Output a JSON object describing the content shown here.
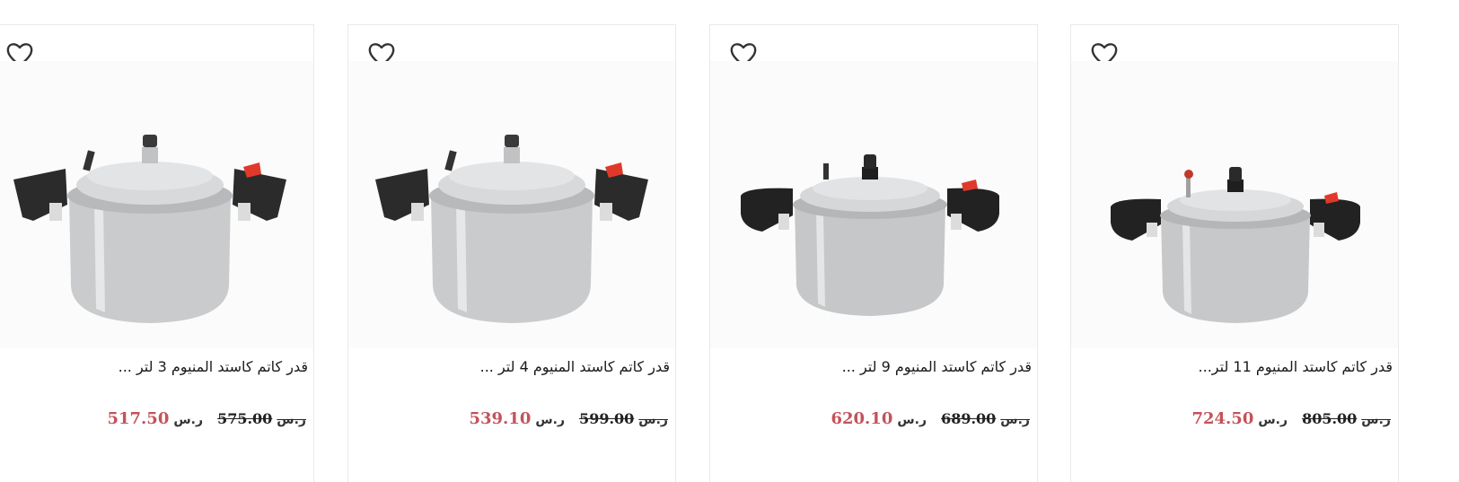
{
  "currency_symbol": "ر.س",
  "products": [
    {
      "title": "قدر كاتم كاستد المنيوم 3 لتر ...",
      "old_price": "575.00",
      "price": "517.50",
      "image_icon": "pressure-cooker-icon"
    },
    {
      "title": "قدر كاتم كاستد المنيوم 4 لتر ...",
      "old_price": "599.00",
      "price": "539.10",
      "image_icon": "pressure-cooker-icon"
    },
    {
      "title": "قدر كاتم كاستد المنيوم 9 لتر ...",
      "old_price": "689.00",
      "price": "620.10",
      "image_icon": "pressure-cooker-icon"
    },
    {
      "title": "قدر كاتم كاستد المنيوم 11 لتر...",
      "old_price": "805.00",
      "price": "724.50",
      "image_icon": "pressure-cooker-icon"
    }
  ],
  "colors": {
    "sale_price": "#c4535a",
    "border": "#e9e9e9",
    "handle": "#2a2a2a",
    "valve_red": "#e0392b",
    "body_silver": "#c9cbcd"
  }
}
